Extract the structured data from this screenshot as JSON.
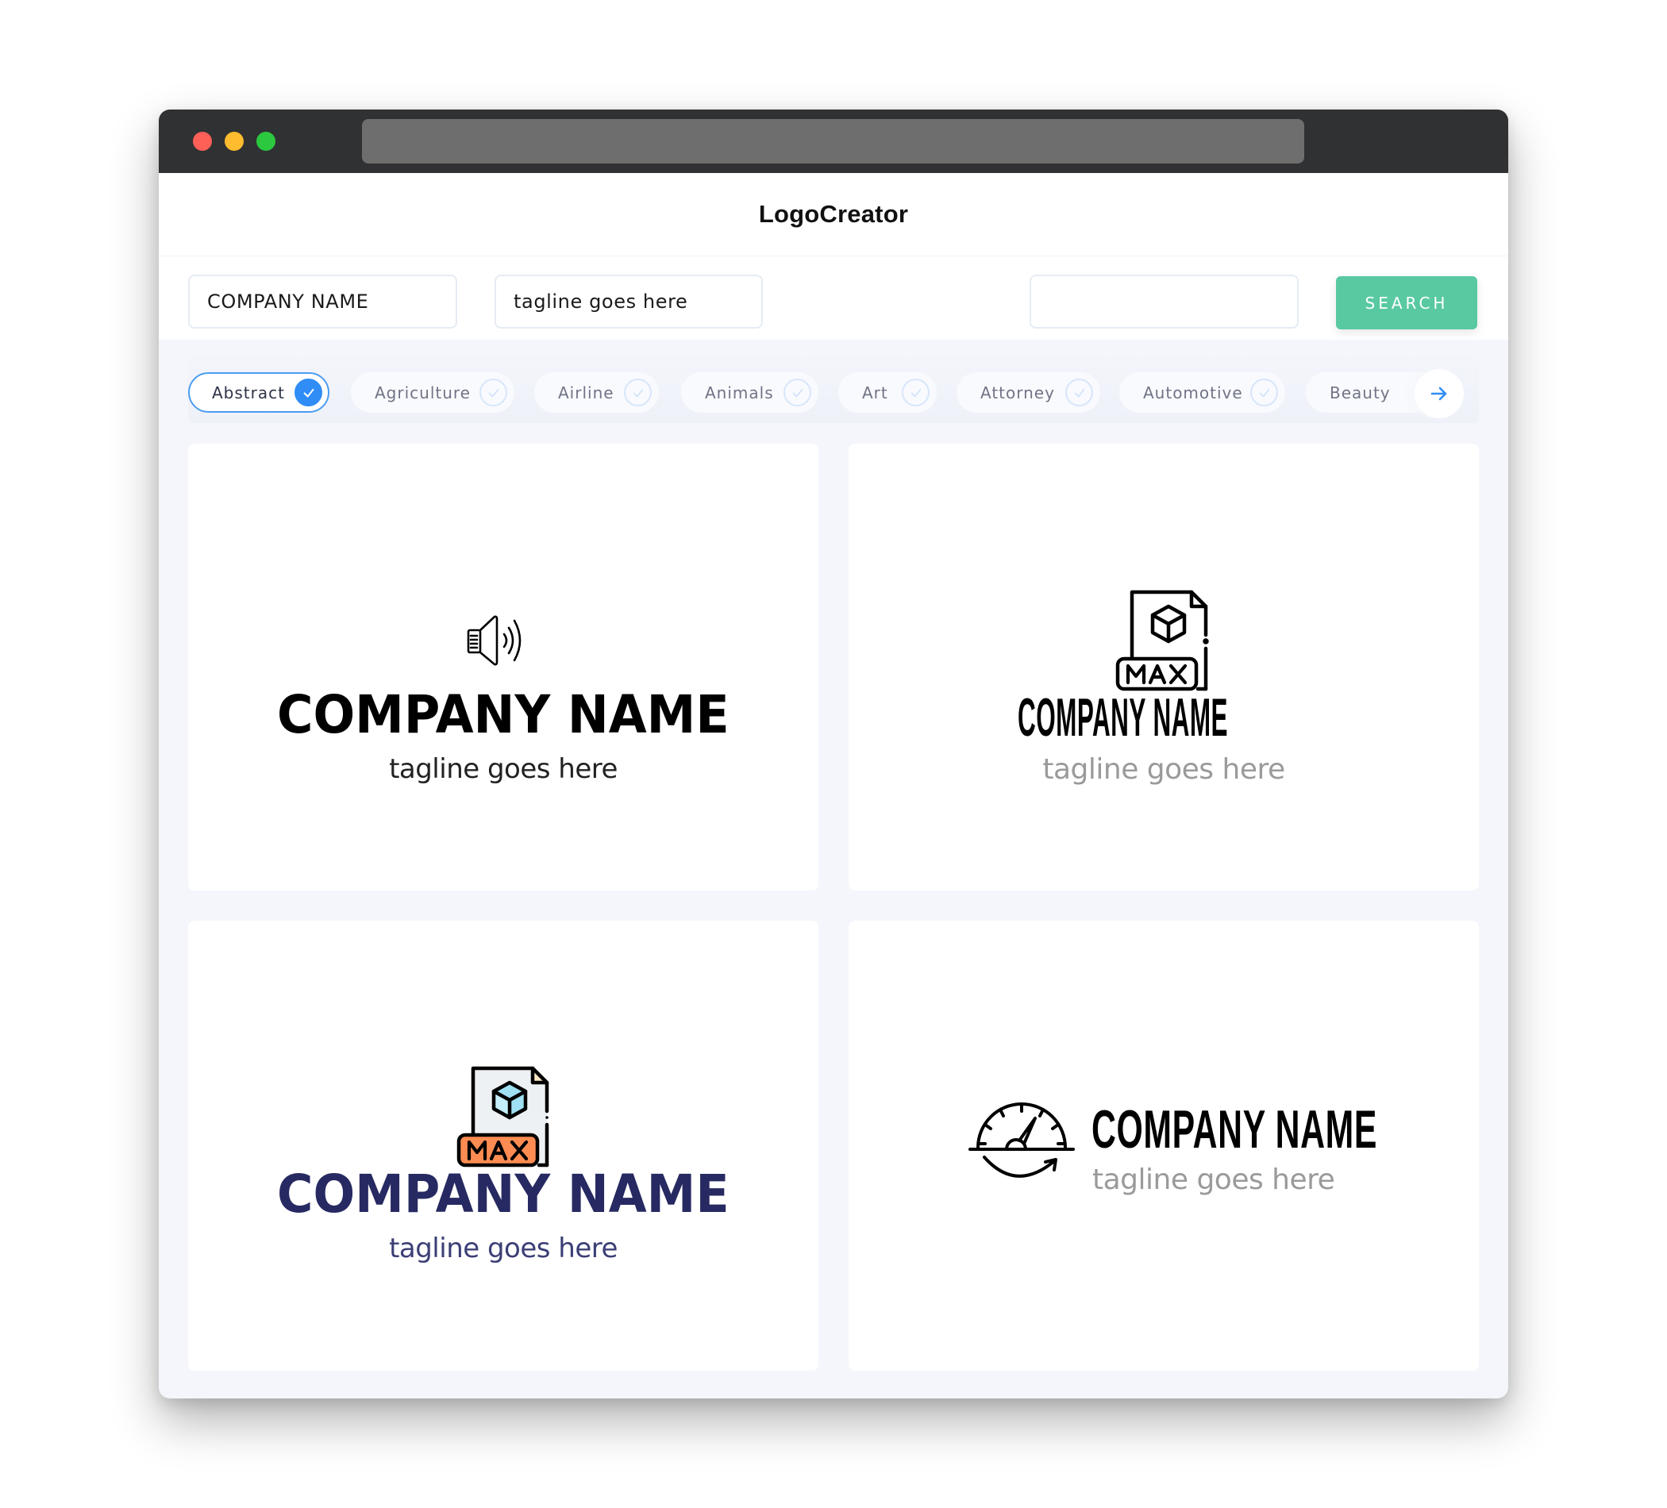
{
  "window": {
    "traffic_lights": [
      "close",
      "minimize",
      "maximize"
    ],
    "address_bar_text": ""
  },
  "header": {
    "brand": "LogoCreator"
  },
  "search_form": {
    "company_field_value": "COMPANY NAME",
    "tagline_field_value": "tagline goes here",
    "keyword_field_value": "",
    "search_button_label": "SEARCH"
  },
  "categories": {
    "items": [
      {
        "label": "Abstract",
        "selected": true
      },
      {
        "label": "Agriculture",
        "selected": false
      },
      {
        "label": "Airline",
        "selected": false
      },
      {
        "label": "Animals",
        "selected": false
      },
      {
        "label": "Art",
        "selected": false
      },
      {
        "label": "Attorney",
        "selected": false
      },
      {
        "label": "Automotive",
        "selected": false
      },
      {
        "label": "Beauty",
        "selected": false
      }
    ],
    "next_icon": "arrow-right-icon"
  },
  "logos": [
    {
      "icon": "speaker-icon",
      "company": "COMPANY NAME",
      "tagline": "tagline goes here",
      "company_color": "#000000",
      "tagline_color": "#222222"
    },
    {
      "icon": "max-file-icon",
      "company": "COMPANY NAME",
      "tagline": "tagline goes here",
      "company_color": "#000000",
      "tagline_color": "#9a9a9a"
    },
    {
      "icon": "max-file-color-icon",
      "company": "COMPANY NAME",
      "tagline": "tagline goes here",
      "company_color": "#272962",
      "tagline_color": "#3c3e75"
    },
    {
      "icon": "speedometer-icon",
      "company": "COMPANY NAME",
      "tagline": "tagline goes here",
      "company_color": "#000000",
      "tagline_color": "#9a9a9a"
    }
  ],
  "colors": {
    "accent_green": "#59c9a2",
    "selected_blue": "#2f8df5",
    "max_orange": "#fd8c52",
    "cube_blue": "#9fe0f2",
    "navy": "#272962"
  }
}
